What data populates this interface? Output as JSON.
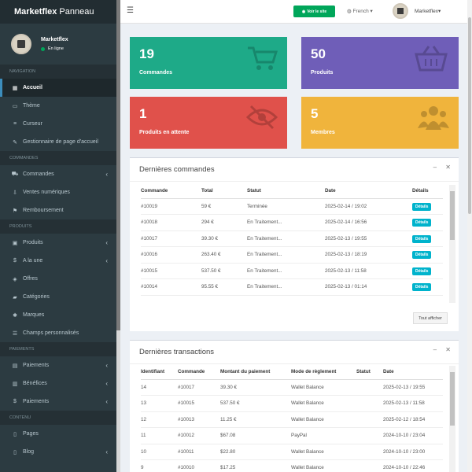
{
  "brand": {
    "bold": "Marketflex",
    "light": "Panneau"
  },
  "user": {
    "name": "Marketflex",
    "status": "En ligne"
  },
  "sidebar": {
    "sections": [
      {
        "header": "NAVIGATION",
        "items": [
          {
            "label": "Accueil",
            "icon": "dashboard-icon",
            "glyph": "▦",
            "active": true
          },
          {
            "label": "Thème",
            "icon": "desktop-icon",
            "glyph": "▭"
          },
          {
            "label": "Curseur",
            "icon": "sliders-icon",
            "glyph": "≡"
          },
          {
            "label": "Gestionnaire de page d'accueil",
            "icon": "edit-icon",
            "glyph": "✎"
          }
        ]
      },
      {
        "header": "COMMANDES",
        "items": [
          {
            "label": "Commandes",
            "icon": "cart-icon",
            "glyph": "⛟",
            "chevron": true
          },
          {
            "label": "Ventes numériques",
            "icon": "download-icon",
            "glyph": "⇩"
          },
          {
            "label": "Remboursement",
            "icon": "flag-icon",
            "glyph": "⚑"
          }
        ]
      },
      {
        "header": "PRODUITS",
        "items": [
          {
            "label": "Produits",
            "icon": "cube-icon",
            "glyph": "▣",
            "chevron": true
          },
          {
            "label": "A la une",
            "icon": "dollar-icon",
            "glyph": "$",
            "chevron": true
          },
          {
            "label": "Offres",
            "icon": "tag-icon",
            "glyph": "◈"
          },
          {
            "label": "Catégories",
            "icon": "folder-icon",
            "glyph": "▰"
          },
          {
            "label": "Marques",
            "icon": "asterisk-icon",
            "glyph": "✱"
          },
          {
            "label": "Champs personnalisés",
            "icon": "list-icon",
            "glyph": "☰"
          }
        ]
      },
      {
        "header": "PAIEMENTS",
        "items": [
          {
            "label": "Paiements",
            "icon": "credit-card-icon",
            "glyph": "▤",
            "chevron": true
          },
          {
            "label": "Bénéfices",
            "icon": "money-icon",
            "glyph": "▥",
            "chevron": true
          },
          {
            "label": "Paiements",
            "icon": "dollar-icon",
            "glyph": "$",
            "chevron": true
          }
        ]
      },
      {
        "header": "CONTENU",
        "items": [
          {
            "label": "Pages",
            "icon": "file-icon",
            "glyph": "▯"
          },
          {
            "label": "Blog",
            "icon": "file-icon",
            "glyph": "▯",
            "chevron": true
          }
        ]
      }
    ]
  },
  "topbar": {
    "visit_label": "Voir le site",
    "language": "French",
    "user_label": "Marketflex"
  },
  "stats": [
    {
      "value": "19",
      "label": "Commandes",
      "color": "#1eaa88",
      "icon": "cart-icon"
    },
    {
      "value": "50",
      "label": "Produits",
      "color": "#6f5eb8",
      "icon": "basket-icon"
    },
    {
      "value": "1",
      "label": "Produits en attente",
      "color": "#e0514b",
      "icon": "eye-slash-icon"
    },
    {
      "value": "5",
      "label": "Membres",
      "color": "#f0b43c",
      "icon": "users-icon"
    }
  ],
  "orders": {
    "title": "Dernières commandes",
    "columns": [
      "Commande",
      "Total",
      "Statut",
      "Date",
      "Détails"
    ],
    "rows": [
      [
        "#10019",
        "59 €",
        "Terminée",
        "2025-02-14 / 19:02",
        "Détails"
      ],
      [
        "#10018",
        "294 €",
        "En Traitement...",
        "2025-02-14 / 16:56",
        "Détails"
      ],
      [
        "#10017",
        "39.30 €",
        "En Traitement...",
        "2025-02-13 / 19:55",
        "Détails"
      ],
      [
        "#10016",
        "263.40 €",
        "En Traitement...",
        "2025-02-13 / 18:19",
        "Détails"
      ],
      [
        "#10015",
        "537.50 €",
        "En Traitement...",
        "2025-02-13 / 11:58",
        "Détails"
      ],
      [
        "#10014",
        "95.55 €",
        "En Traitement...",
        "2025-02-13 / 01:14",
        "Détails"
      ]
    ],
    "show_all": "Tout afficher"
  },
  "transactions": {
    "title": "Dernières transactions",
    "columns": [
      "Identifiant",
      "Commande",
      "Montant du paiement",
      "Mode de règlement",
      "Statut",
      "Date"
    ],
    "rows": [
      [
        "14",
        "#10017",
        "39.30 €",
        "Wallet Balance",
        "",
        "2025-02-13 / 19:55"
      ],
      [
        "13",
        "#10015",
        "537.50 €",
        "Wallet Balance",
        "",
        "2025-02-13 / 11:58"
      ],
      [
        "12",
        "#10013",
        "11.25 €",
        "Wallet Balance",
        "",
        "2025-02-12 / 18:54"
      ],
      [
        "11",
        "#10012",
        "$67.08",
        "PayPal",
        "",
        "2024-10-10 / 23:04"
      ],
      [
        "10",
        "#10011",
        "$22.80",
        "Wallet Balance",
        "",
        "2024-10-10 / 23:00"
      ],
      [
        "9",
        "#10010",
        "$17.25",
        "Wallet Balance",
        "",
        "2024-10-10 / 22:46"
      ]
    ]
  }
}
